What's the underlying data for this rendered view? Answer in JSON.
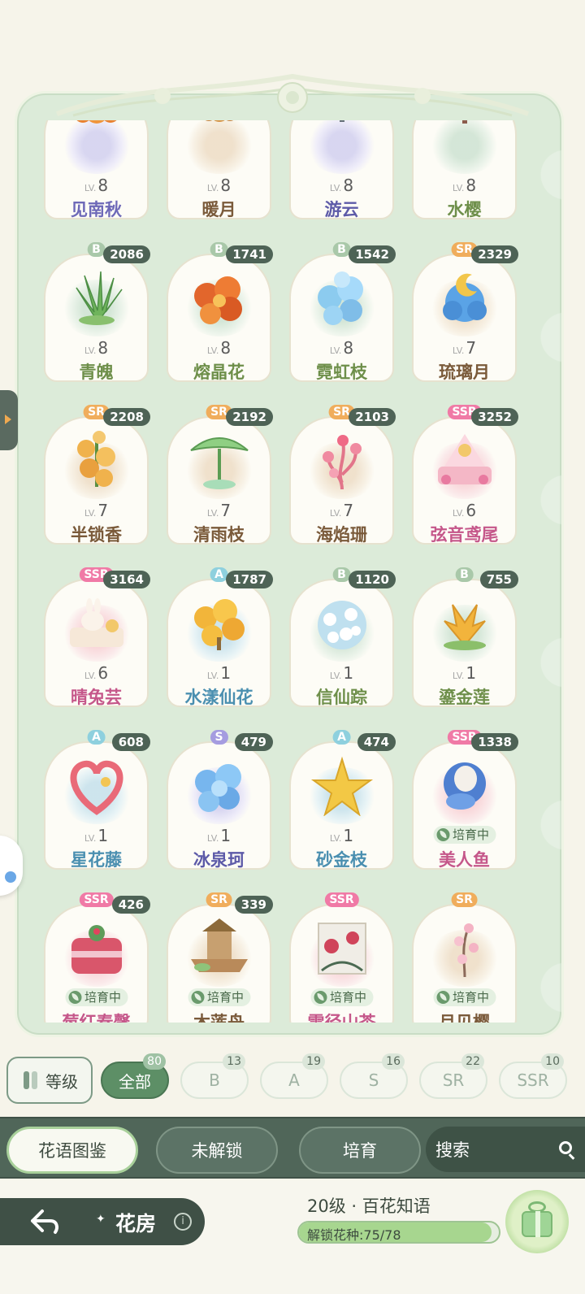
{
  "cards": [
    {
      "rarity": "",
      "count": "",
      "level": "8",
      "name": "见南秋",
      "status": "",
      "plant": "autumn",
      "nameColor": "c-purple",
      "rclass": "r-s"
    },
    {
      "rarity": "",
      "count": "",
      "level": "8",
      "name": "暖月",
      "status": "",
      "plant": "warm",
      "nameColor": "c-brown",
      "rclass": "r-sr"
    },
    {
      "rarity": "",
      "count": "",
      "level": "8",
      "name": "游云",
      "status": "",
      "plant": "cloud",
      "nameColor": "c-indigo",
      "rclass": "r-s"
    },
    {
      "rarity": "",
      "count": "",
      "level": "8",
      "name": "水樱",
      "status": "",
      "plant": "sakura",
      "nameColor": "c-green",
      "rclass": "r-b"
    },
    {
      "rarity": "B",
      "count": "2086",
      "level": "8",
      "name": "青魄",
      "status": "",
      "plant": "aloe",
      "nameColor": "c-green",
      "rclass": "r-b"
    },
    {
      "rarity": "B",
      "count": "1741",
      "level": "8",
      "name": "熔晶花",
      "status": "",
      "plant": "orange",
      "nameColor": "c-green",
      "rclass": "r-b"
    },
    {
      "rarity": "B",
      "count": "1542",
      "level": "8",
      "name": "霓虹枝",
      "status": "",
      "plant": "iceblue",
      "nameColor": "c-green",
      "rclass": "r-b"
    },
    {
      "rarity": "SR",
      "count": "2329",
      "level": "7",
      "name": "琉璃月",
      "status": "",
      "plant": "moon",
      "nameColor": "c-brown",
      "rclass": "r-sr"
    },
    {
      "rarity": "SR",
      "count": "2208",
      "level": "7",
      "name": "半锁香",
      "status": "",
      "plant": "yellowrose",
      "nameColor": "c-brown",
      "rclass": "r-sr"
    },
    {
      "rarity": "SR",
      "count": "2192",
      "level": "7",
      "name": "清雨枝",
      "status": "",
      "plant": "umbrella",
      "nameColor": "c-brown",
      "rclass": "r-sr"
    },
    {
      "rarity": "SR",
      "count": "2103",
      "level": "7",
      "name": "海焰珊",
      "status": "",
      "plant": "coral",
      "nameColor": "c-brown",
      "rclass": "r-sr"
    },
    {
      "rarity": "SSR",
      "count": "3252",
      "level": "6",
      "name": "弦音鸢尾",
      "status": "",
      "plant": "pinkstage",
      "nameColor": "c-pink",
      "rclass": "r-ssr"
    },
    {
      "rarity": "SSR",
      "count": "3164",
      "level": "6",
      "name": "晴兔芸",
      "status": "",
      "plant": "rabbit",
      "nameColor": "c-pink",
      "rclass": "r-ssr"
    },
    {
      "rarity": "A",
      "count": "1787",
      "level": "1",
      "name": "水漾仙花",
      "status": "",
      "plant": "goldbush",
      "nameColor": "c-blue",
      "rclass": "r-a"
    },
    {
      "rarity": "B",
      "count": "1120",
      "level": "1",
      "name": "信仙踪",
      "status": "",
      "plant": "whiteflower",
      "nameColor": "c-green",
      "rclass": "r-b"
    },
    {
      "rarity": "B",
      "count": "755",
      "level": "1",
      "name": "鎏金莲",
      "status": "",
      "plant": "lotus",
      "nameColor": "c-green",
      "rclass": "r-b"
    },
    {
      "rarity": "A",
      "count": "608",
      "level": "1",
      "name": "星花藤",
      "status": "",
      "plant": "heart",
      "nameColor": "c-blue",
      "rclass": "r-a"
    },
    {
      "rarity": "S",
      "count": "479",
      "level": "1",
      "name": "冰泉珂",
      "status": "",
      "plant": "iceball",
      "nameColor": "c-indigo",
      "rclass": "r-s"
    },
    {
      "rarity": "A",
      "count": "474",
      "level": "1",
      "name": "砂金枝",
      "status": "",
      "plant": "goldstar",
      "nameColor": "c-blue",
      "rclass": "r-a"
    },
    {
      "rarity": "SSR",
      "count": "1338",
      "level": "",
      "name": "美人鱼",
      "status": "培育中",
      "plant": "mermaid",
      "nameColor": "c-pink",
      "rclass": "r-ssr"
    },
    {
      "rarity": "SSR",
      "count": "426",
      "level": "",
      "name": "莓红春馨",
      "status": "培育中",
      "plant": "cake",
      "nameColor": "c-pink",
      "rclass": "r-ssr"
    },
    {
      "rarity": "SR",
      "count": "339",
      "level": "",
      "name": "木莲舟",
      "status": "培育中",
      "plant": "boat",
      "nameColor": "c-brown",
      "rclass": "r-sr"
    },
    {
      "rarity": "SSR",
      "count": "",
      "level": "",
      "name": "雪径山茶",
      "status": "培育中",
      "plant": "camellia",
      "nameColor": "c-pink",
      "rclass": "r-ssr"
    },
    {
      "rarity": "SR",
      "count": "",
      "level": "",
      "name": "月见樱",
      "status": "培育中",
      "plant": "branch",
      "nameColor": "c-brown",
      "rclass": "r-sr"
    }
  ],
  "filters": {
    "sort_label": "等级",
    "chips": [
      {
        "label": "全部",
        "count": "80"
      },
      {
        "label": "B",
        "count": "13"
      },
      {
        "label": "A",
        "count": "19"
      },
      {
        "label": "S",
        "count": "16"
      },
      {
        "label": "SR",
        "count": "22"
      },
      {
        "label": "SSR",
        "count": "10"
      }
    ]
  },
  "tabs": {
    "items": [
      "花语图鉴",
      "未解锁",
      "培育"
    ],
    "search_label": "搜索"
  },
  "bottom": {
    "home_label": "花房",
    "info_glyph": "i",
    "level_title": "20级 · 百花知语",
    "unlock_label": "解锁花种:75/78",
    "unlock_fraction": 0.9615
  },
  "lv_prefix": "LV."
}
